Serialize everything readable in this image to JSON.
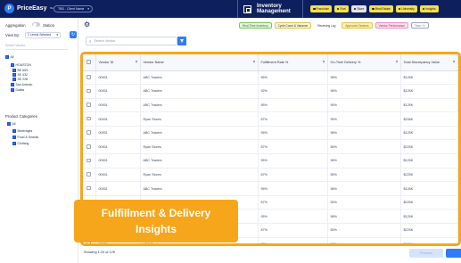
{
  "app": {
    "logo_text": "PriceEasy",
    "logo_tm": "™",
    "client_select": "TBD - Client Name",
    "module_title": "Inventory Management"
  },
  "top_chips": [
    {
      "label": "Franchise",
      "color": "#f6e04a"
    },
    {
      "label": "Fuel",
      "color": "#f6e04a"
    },
    {
      "label": "Store",
      "color": "#e3e3e8"
    },
    {
      "label": "Real Estate",
      "color": "#f6e04a"
    },
    {
      "label": "University",
      "color": "#f6e04a"
    },
    {
      "label": "Insights",
      "color": "#f6e04a"
    }
  ],
  "sidebar": {
    "aggregation_label": "Aggregation",
    "station_label": "Station",
    "viewby_label": "View By:",
    "viewby_value": "2 Levels Selected",
    "search_placeholder": "Search Vendor...",
    "tree": [
      {
        "label": "All",
        "checked": true
      },
      {
        "label": "HOUSTON",
        "checked": true
      },
      {
        "label": "BE 653",
        "checked": true
      },
      {
        "label": "SE 432",
        "checked": true
      },
      {
        "label": "SE 228",
        "checked": true
      },
      {
        "label": "San Antonio",
        "checked": true
      },
      {
        "label": "Dallas",
        "checked": true
      }
    ],
    "product_categories_label": "Product Categories",
    "categories": [
      {
        "label": "All",
        "checked": true
      },
      {
        "label": "Beverages",
        "checked": true
      },
      {
        "label": "Food & Snacks",
        "checked": true
      },
      {
        "label": "Clothing",
        "checked": true
      }
    ]
  },
  "tabs": [
    {
      "label": "Real-Time Inventory",
      "bg": "#e4f5dc",
      "border": "#7cc35a",
      "color": "#2e7d1f"
    },
    {
      "label": "Cycle Count & Variance",
      "bg": "#fff5cc",
      "border": "#e0c54a",
      "color": "#1f2a44"
    },
    {
      "label": "Receiving Log",
      "bg": "#ffffff",
      "border": "#ffffff",
      "color": "#1f2a44"
    },
    {
      "label": "Approved Vendors",
      "bg": "#fff0b3",
      "border": "#e6c340",
      "color": "#8a6a00"
    },
    {
      "label": "Vendor Performance",
      "bg": "#fbe0ef",
      "border": "#f090c4",
      "color": "#c2186b"
    },
    {
      "label": "Time / V",
      "bg": "#ffffff",
      "border": "#9aa3bd",
      "color": "#6d7895"
    }
  ],
  "search": {
    "placeholder": "Search Vendor"
  },
  "table": {
    "columns": [
      "Vendor ID",
      "Vendor Name",
      "Fulfillment Rate %",
      "On-Time Delivery %",
      "Total Discrepancy Value"
    ],
    "rows": [
      [
        "00001",
        "ABC Traders",
        "95%",
        "98%",
        "$125K"
      ],
      [
        "00001",
        "ABC Traders",
        "92%",
        "96%",
        "$126K"
      ],
      [
        "00001",
        "ABC Traders",
        "95%",
        "95%",
        "$125K"
      ],
      [
        "00001",
        "Ryan Stores",
        "87%",
        "95%",
        "$236K"
      ],
      [
        "00001",
        "ABC Traders",
        "95%",
        "98%",
        "$125K"
      ],
      [
        "00001",
        "Ryan Stores",
        "87%",
        "55%",
        "$225K"
      ],
      [
        "00001",
        "ABC Traders",
        "95%",
        "98%",
        "$125K"
      ],
      [
        "00001",
        "Ryan Stores",
        "87%",
        "55%",
        "$225K"
      ],
      [
        "00001",
        "ABC Traders",
        "95%",
        "98%",
        "$126K"
      ],
      [
        "00001",
        "Ryan Stores",
        "87%",
        "55%",
        "$225K"
      ],
      [
        "00001",
        "ABC Traders",
        "95%",
        "98%",
        "$125K"
      ],
      [
        "00001",
        "Ryan Stores",
        "87%",
        "55%",
        "$225K"
      ],
      [
        "00001",
        "ABC Traders",
        "95%",
        "98%",
        "$126K"
      ]
    ]
  },
  "footer": {
    "showing": "Showing 1-20 of 125",
    "prev_label": "Previous"
  },
  "overlay": {
    "line1": "Fulfillment & Delivery",
    "line2": "Insights"
  }
}
